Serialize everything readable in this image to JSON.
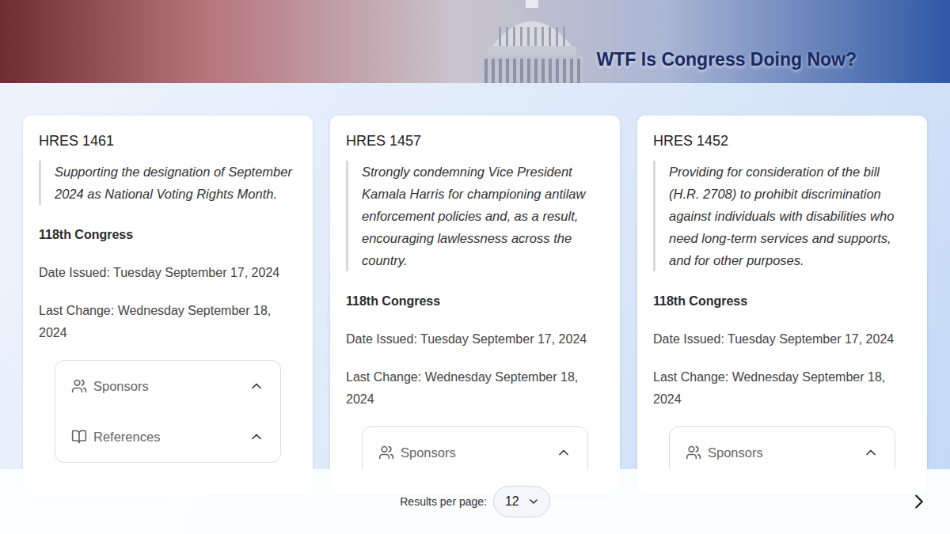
{
  "header": {
    "title": "WTF Is Congress Doing Now?"
  },
  "bills": [
    {
      "id": "HRES 1461",
      "title": "Supporting the designation of September 2024 as National Voting Rights Month.",
      "congress": "118th Congress",
      "issued": "Date Issued: Tuesday September 17, 2024",
      "changed": "Last Change: Wednesday September 18, 2024",
      "sections": [
        {
          "label": "Sponsors",
          "kind": "sponsors",
          "expanded": true
        },
        {
          "label": "References",
          "kind": "references",
          "expanded": true
        }
      ]
    },
    {
      "id": "HRES 1457",
      "title": "Strongly condemning Vice President Kamala Harris for championing antilaw enforcement policies and, as a result, encouraging lawlessness across the country.",
      "congress": "118th Congress",
      "issued": "Date Issued: Tuesday September 17, 2024",
      "changed": "Last Change: Wednesday September 18, 2024",
      "sections": [
        {
          "label": "Sponsors",
          "kind": "sponsors",
          "expanded": true
        }
      ]
    },
    {
      "id": "HRES 1452",
      "title": "Providing for consideration of the bill (H.R. 2708) to prohibit discrimination against individuals with disabilities who need long-term services and supports, and for other purposes.",
      "congress": "118th Congress",
      "issued": "Date Issued: Tuesday September 17, 2024",
      "changed": "Last Change: Wednesday September 18, 2024",
      "sections": [
        {
          "label": "Sponsors",
          "kind": "sponsors",
          "expanded": true
        }
      ]
    }
  ],
  "pagination": {
    "label": "Results per page:",
    "value": "12"
  }
}
